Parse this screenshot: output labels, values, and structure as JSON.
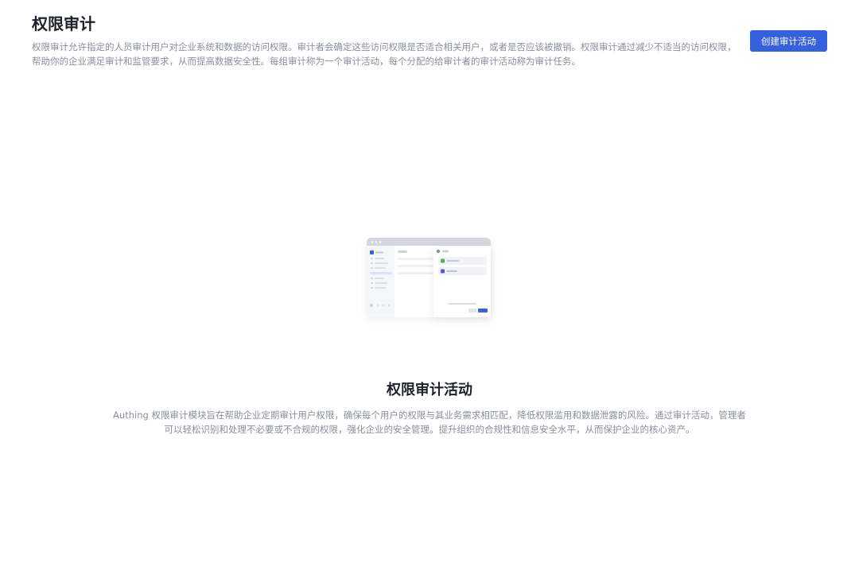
{
  "header": {
    "title": "权限审计",
    "description": "权限审计允许指定的人员审计用户对企业系统和数据的访问权限。审计者会确定这些访问权限是否适合相关用户，或者是否应该被撤销。权限审计通过减少不适当的访问权限，帮助你的企业满足审计和监管要求，从而提高数据安全性。每组审计称为一个审计活动，每个分配的给审计者的审计活动称为审计任务。",
    "create_button_label": "创建审计活动"
  },
  "empty_state": {
    "illustration_icon": "audit-activity-illustration",
    "title": "权限审计活动",
    "description": "Authing 权限审计模块旨在帮助企业定期审计用户权限，确保每个用户的权限与其业务需求相匹配，降低权限滥用和数据泄露的风险。通过审计活动，管理者可以轻松识别和处理不必要或不合规的权限，强化企业的安全管理。提升组织的合规性和信息安全水平，从而保护企业的核心资产。"
  },
  "colors": {
    "primary": "#3560e0",
    "title_text": "#1f2329",
    "muted_text": "#8a8f99"
  }
}
